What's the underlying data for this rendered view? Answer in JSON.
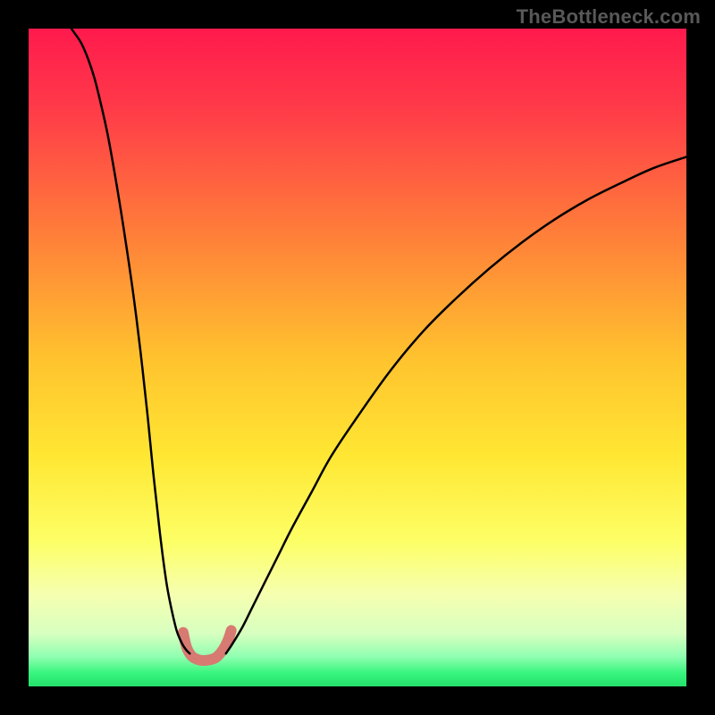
{
  "watermark": "TheBottleneck.com",
  "chart_data": {
    "type": "line",
    "title": "",
    "xlabel": "",
    "ylabel": "",
    "xlim": [
      0,
      100
    ],
    "ylim": [
      0,
      100
    ],
    "grid": false,
    "annotations": [
      "TheBottleneck.com"
    ],
    "background_gradient": {
      "stops": [
        {
          "offset": 0.0,
          "color": "#ff1a4d"
        },
        {
          "offset": 0.12,
          "color": "#ff3a49"
        },
        {
          "offset": 0.3,
          "color": "#ff7a3a"
        },
        {
          "offset": 0.5,
          "color": "#ffc22e"
        },
        {
          "offset": 0.65,
          "color": "#ffe733"
        },
        {
          "offset": 0.78,
          "color": "#fdff66"
        },
        {
          "offset": 0.86,
          "color": "#f6ffb0"
        },
        {
          "offset": 0.92,
          "color": "#d7ffc0"
        },
        {
          "offset": 0.955,
          "color": "#8fffb0"
        },
        {
          "offset": 0.98,
          "color": "#37f57d"
        },
        {
          "offset": 1.0,
          "color": "#23e06a"
        }
      ]
    },
    "series": [
      {
        "name": "left-branch",
        "color": "#000000",
        "stroke_width": 2.5,
        "x": [
          24.5,
          24.0,
          23.5,
          23.0,
          22.5,
          22.0,
          21.5,
          21.0,
          20.5,
          20.0,
          19.5,
          19.0,
          18.5,
          18.0,
          17.0,
          16.0,
          15.0,
          14.0,
          13.0,
          12.0,
          11.0,
          10.0,
          9.0,
          8.0,
          7.0,
          6.5
        ],
        "y": [
          5.0,
          5.5,
          6.2,
          7.2,
          8.5,
          10.5,
          12.8,
          15.5,
          19.0,
          23.0,
          27.5,
          32.0,
          37.0,
          42.0,
          51.0,
          59.0,
          66.0,
          72.5,
          78.5,
          84.0,
          88.5,
          92.5,
          95.5,
          97.8,
          99.3,
          100.0
        ]
      },
      {
        "name": "right-branch",
        "color": "#000000",
        "stroke_width": 2.5,
        "x": [
          30.0,
          31.0,
          32.5,
          34.0,
          36.0,
          38.0,
          40.0,
          43.0,
          46.0,
          50.0,
          55.0,
          60.0,
          65.0,
          70.0,
          75.0,
          80.0,
          85.0,
          90.0,
          95.0,
          100.0
        ],
        "y": [
          5.0,
          6.5,
          9.0,
          12.0,
          16.0,
          20.0,
          24.0,
          29.5,
          35.0,
          41.0,
          48.0,
          54.0,
          59.0,
          63.5,
          67.5,
          71.0,
          74.0,
          76.5,
          78.8,
          80.5
        ]
      },
      {
        "name": "valley-marker",
        "type": "highlight-band",
        "color": "#d77a72",
        "stroke_width": 12,
        "x": [
          23.5,
          24.0,
          24.8,
          26.0,
          27.3,
          28.5,
          29.5,
          30.3,
          30.8
        ],
        "y": [
          8.2,
          6.0,
          4.6,
          4.0,
          4.0,
          4.4,
          5.5,
          7.0,
          8.5
        ]
      }
    ]
  }
}
